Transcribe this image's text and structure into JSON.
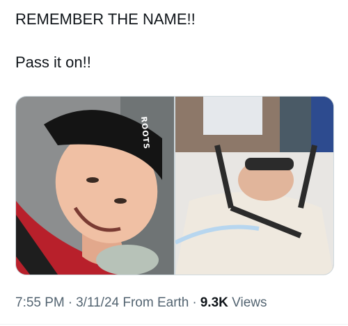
{
  "post": {
    "text_line1": "REMEMBER THE NAME!!",
    "text_line2": "Pass it on!!",
    "images": [
      {
        "label": "smiling boy in black cap",
        "cap_text": "ROOTS"
      },
      {
        "label": "patient in hospital bed with halo brace"
      }
    ],
    "meta": {
      "time": "7:55 PM",
      "date": "3/11/24",
      "source": "From Earth",
      "views_count": "9.3K",
      "views_label": "Views"
    }
  },
  "colors": {
    "text": "#0f1419",
    "muted": "#536471",
    "border": "#cfd9de"
  }
}
